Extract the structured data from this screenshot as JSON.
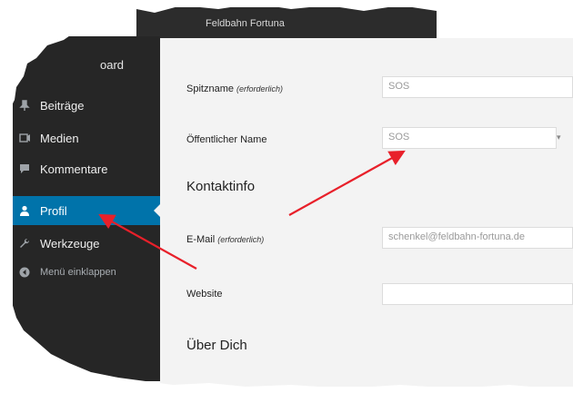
{
  "admin_bar": {
    "site_title": "Feldbahn Fortuna"
  },
  "sidebar": {
    "partial_top_label": "oard",
    "items": [
      {
        "label": "Beiträge",
        "icon": "pin-icon"
      },
      {
        "label": "Medien",
        "icon": "media-icon"
      },
      {
        "label": "Kommentare",
        "icon": "comment-icon"
      },
      {
        "label": "Profil",
        "icon": "user-icon",
        "active": true
      },
      {
        "label": "Werkzeuge",
        "icon": "wrench-icon"
      },
      {
        "label": "Menü einklappen",
        "icon": "collapse-icon"
      }
    ]
  },
  "profile_form": {
    "nickname": {
      "label": "Spitzname",
      "hint": "(erforderlich)",
      "value": "SOS"
    },
    "display_name": {
      "label": "Öffentlicher Name",
      "value": "SOS"
    },
    "contact_heading": "Kontaktinfo",
    "email": {
      "label": "E-Mail",
      "hint": "(erforderlich)",
      "value": "schenkel@feldbahn-fortuna.de"
    },
    "website": {
      "label": "Website",
      "value": ""
    },
    "about_heading": "Über Dich"
  },
  "colors": {
    "sidebar_bg": "#262626",
    "active_bg": "#0073aa",
    "content_bg": "#f3f3f3",
    "arrow": "#e8202a"
  }
}
